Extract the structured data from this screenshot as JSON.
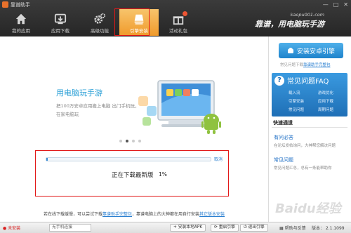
{
  "app": {
    "title": "靠谱助手"
  },
  "window_controls": {
    "min": "—",
    "max": "□",
    "close": "✕"
  },
  "nav": [
    {
      "label": "我的应用",
      "icon": "home-icon"
    },
    {
      "label": "应用下载",
      "icon": "download-icon"
    },
    {
      "label": "高级功能",
      "icon": "gear-icon"
    },
    {
      "label": "引擎安装",
      "icon": "engine-icon",
      "active": true
    },
    {
      "label": "活动礼包",
      "icon": "gift-icon"
    }
  ],
  "header": {
    "site_url": "kaopu001.com",
    "slogan": "靠谱，用电脑玩手游"
  },
  "hero": {
    "title": "用电脑玩手游",
    "desc": "把100万安卓应用搬上电脑 出门手机玩，在家电脑玩"
  },
  "carousel": {
    "count": 4,
    "active_index": 1
  },
  "download": {
    "cancel_label": "取消",
    "status": "正在下载最新版",
    "percent_label": "1%",
    "progress": 0.01
  },
  "footer": {
    "text_1": "若在线下载缓慢，可以尝试下载",
    "link_1": "靠谱助手完整包",
    "text_2": "，靠谱电脑上的大神都在用自行安装",
    "link_2": "其它版本安装"
  },
  "sidebar": {
    "install_label": "安装安卓引擎",
    "install_hint_prefix": "常见问题下载",
    "install_hint_link": "靠谱助手完整包",
    "faq_title": "常见问题FAQ",
    "faq_links": [
      "载入流",
      "游戏优化",
      "引擎安装",
      "应用下载",
      "常见问题",
      "周期问题"
    ],
    "quick_header": "快速通道",
    "quick_links": [
      {
        "title": "有问必答",
        "desc": "在论坛发帖询问，大神帮您解决问题"
      },
      {
        "title": "常见问题",
        "desc": "常见问题汇总，总有一条能帮助你"
      }
    ]
  },
  "statusbar": {
    "left_status": "未安装",
    "select_value": "无手机连接",
    "btn_install_apk": "安装本地APK",
    "btn_restart": "重启引擎",
    "btn_exit": "退出引擎",
    "help_label": "帮助与反馈",
    "version_label": "版本： 2.1.1099"
  },
  "watermark": "Baidu经验",
  "colors": {
    "accent": "#2a9fd6",
    "highlight": "#e21818",
    "nav_active": "#f09a2b"
  }
}
